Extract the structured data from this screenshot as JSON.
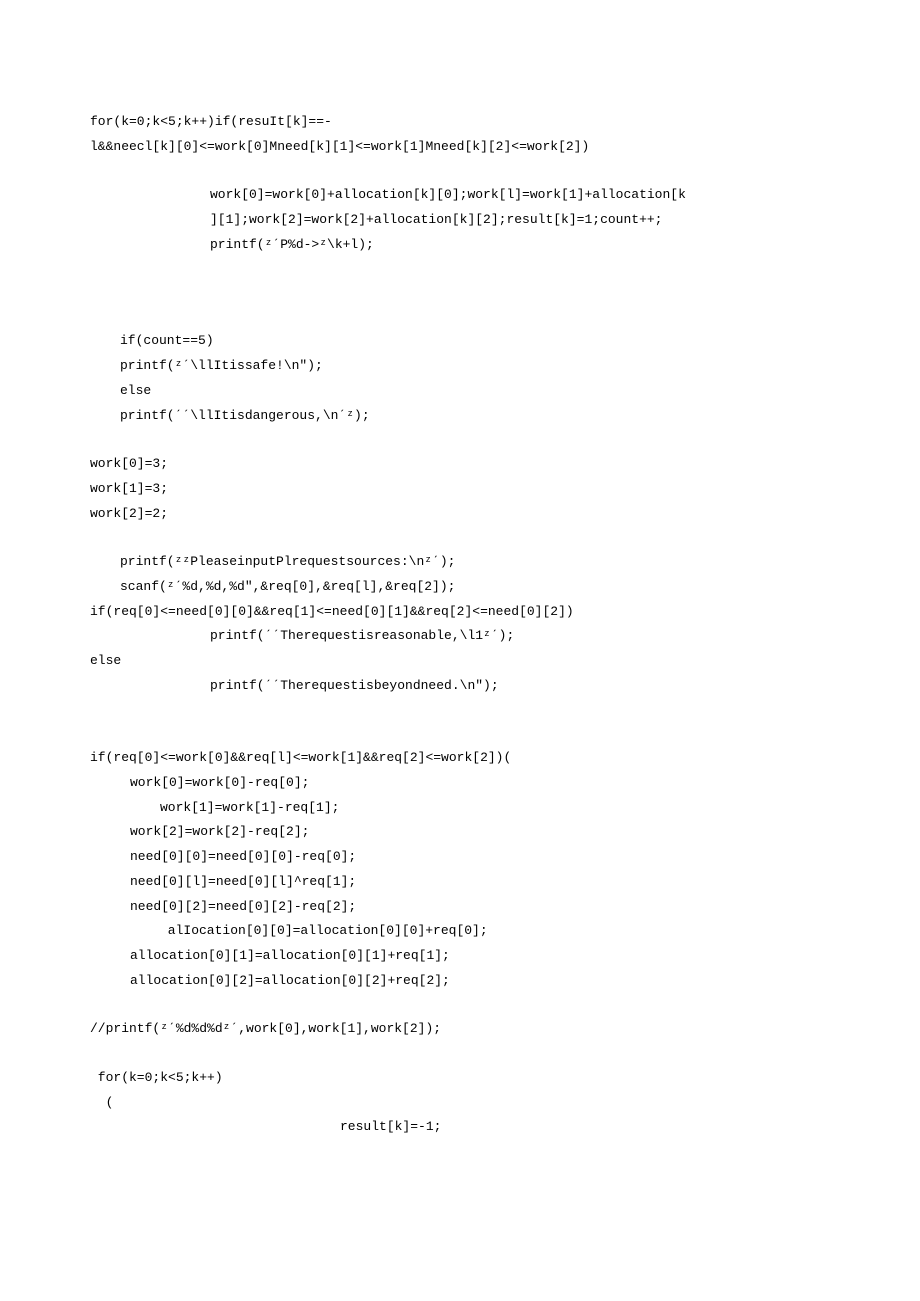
{
  "lines": [
    {
      "cls": "indent1",
      "text": "for(k=0;k<5;k++)if(resuIt[k]==-"
    },
    {
      "cls": "indent1",
      "text": "l&&neecl[k][0]<=work[0]Mneed[k][1]<=work[1]Mneed[k][2]<=work[2])"
    },
    {
      "cls": "blank",
      "text": ""
    },
    {
      "cls": "indent2",
      "text": "work[0]=work[0]+allocation[k][0];work[l]=work[1]+allocation[k"
    },
    {
      "cls": "indent2",
      "text": "][1];work[2]=work[2]+allocation[k][2];result[k]=1;count++;"
    },
    {
      "cls": "indent2",
      "text": "printf(ᶻˊP%d->ᶻ\\k+l);"
    },
    {
      "cls": "blank",
      "text": ""
    },
    {
      "cls": "blank",
      "text": ""
    },
    {
      "cls": "blank",
      "text": ""
    },
    {
      "cls": "indent3",
      "text": "if(count==5)"
    },
    {
      "cls": "indent3",
      "text": "printf(ᶻˊ\\llItissafe!\\n″);"
    },
    {
      "cls": "indent3",
      "text": "else"
    },
    {
      "cls": "indent3",
      "text": "printf(ˊˊ\\llItisdangerous,\\nˊᶻ);"
    },
    {
      "cls": "blank",
      "text": ""
    },
    {
      "cls": "indent1",
      "text": "work[0]=3;"
    },
    {
      "cls": "indent1",
      "text": "work[1]=3;"
    },
    {
      "cls": "indent1",
      "text": "work[2]=2;"
    },
    {
      "cls": "blank",
      "text": ""
    },
    {
      "cls": "indent3",
      "text": "printf(ᶻᶻPleaseinputPlrequestsources:\\nᶻˊ);"
    },
    {
      "cls": "indent3",
      "text": "scanf(ᶻˊ%d,%d,%d\",&req[0],&req[l],&req[2]);"
    },
    {
      "cls": "indent1",
      "text": "if(req[0]<=need[0][0]&&req[1]<=need[0][1]&&req[2]<=need[0][2])"
    },
    {
      "cls": "indent2",
      "text": "printf(ˊˊTherequestisreasonable,\\l1ᶻˊ);"
    },
    {
      "cls": "indent1",
      "text": "else"
    },
    {
      "cls": "indent2",
      "text": "printf(ˊˊTherequestisbeyondneed.\\n″);"
    },
    {
      "cls": "blank",
      "text": ""
    },
    {
      "cls": "blank",
      "text": ""
    },
    {
      "cls": "indent1",
      "text": "if(req[0]<=work[0]&&req[l]<=work[1]&&req[2]<=work[2])("
    },
    {
      "cls": "indent5",
      "text": "work[0]=work[0]-req[0];"
    },
    {
      "cls": "indent4",
      "text": "work[1]=work[1]-req[1];"
    },
    {
      "cls": "indent5",
      "text": "work[2]=work[2]-req[2];"
    },
    {
      "cls": "indent5",
      "text": "need[0][0]=need[0][0]-req[0];"
    },
    {
      "cls": "indent5",
      "text": "need[0][l]=need[0][l]^req[1];"
    },
    {
      "cls": "indent5",
      "text": "need[0][2]=need[0][2]-req[2];"
    },
    {
      "cls": "indent4",
      "text": " alIocation[0][0]=allocation[0][0]+req[0];"
    },
    {
      "cls": "indent5",
      "text": "allocation[0][1]=allocation[0][1]+req[1];"
    },
    {
      "cls": "indent5",
      "text": "allocation[0][2]=allocation[0][2]+req[2];"
    },
    {
      "cls": "blank",
      "text": ""
    },
    {
      "cls": "indent1",
      "text": "//printf(ᶻˊ%d%d%dᶻˊ,work[0],work[1],work[2]);"
    },
    {
      "cls": "blank",
      "text": ""
    },
    {
      "cls": "indent1",
      "text": " for(k=0;k<5;k++)"
    },
    {
      "cls": "indent1",
      "text": "  ("
    },
    {
      "cls": "indent6",
      "text": "result[k]=-1;"
    }
  ]
}
